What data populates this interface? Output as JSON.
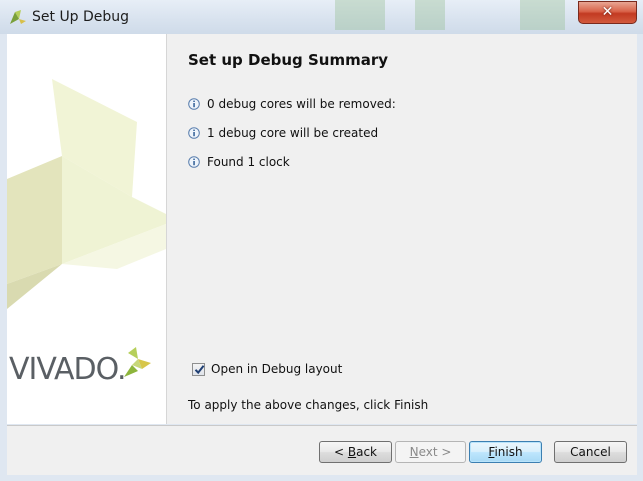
{
  "window": {
    "title": "Set Up Debug",
    "close_label": "✕"
  },
  "sidebar": {
    "logo_text": "VIVADO."
  },
  "summary": {
    "heading": "Set up Debug Summary",
    "items": [
      {
        "icon": "info-icon",
        "text": "0 debug cores will be removed:"
      },
      {
        "icon": "info-icon",
        "text": "1 debug core will be created"
      },
      {
        "icon": "info-icon",
        "text": "Found 1 clock"
      }
    ],
    "open_debug_layout": {
      "label": "Open in Debug layout",
      "checked": true
    },
    "hint": "To apply the above changes, click Finish"
  },
  "buttons": {
    "back": {
      "prefix": "< ",
      "mnemonic": "B",
      "rest": "ack"
    },
    "next": {
      "mnemonic": "N",
      "rest": "ext >"
    },
    "finish": {
      "mnemonic": "F",
      "rest": "inish"
    },
    "cancel": "Cancel"
  },
  "colors": {
    "accent_default_button": "#3c7fb1",
    "close_button": "#c23a22",
    "logo_green": "#8db53c"
  }
}
